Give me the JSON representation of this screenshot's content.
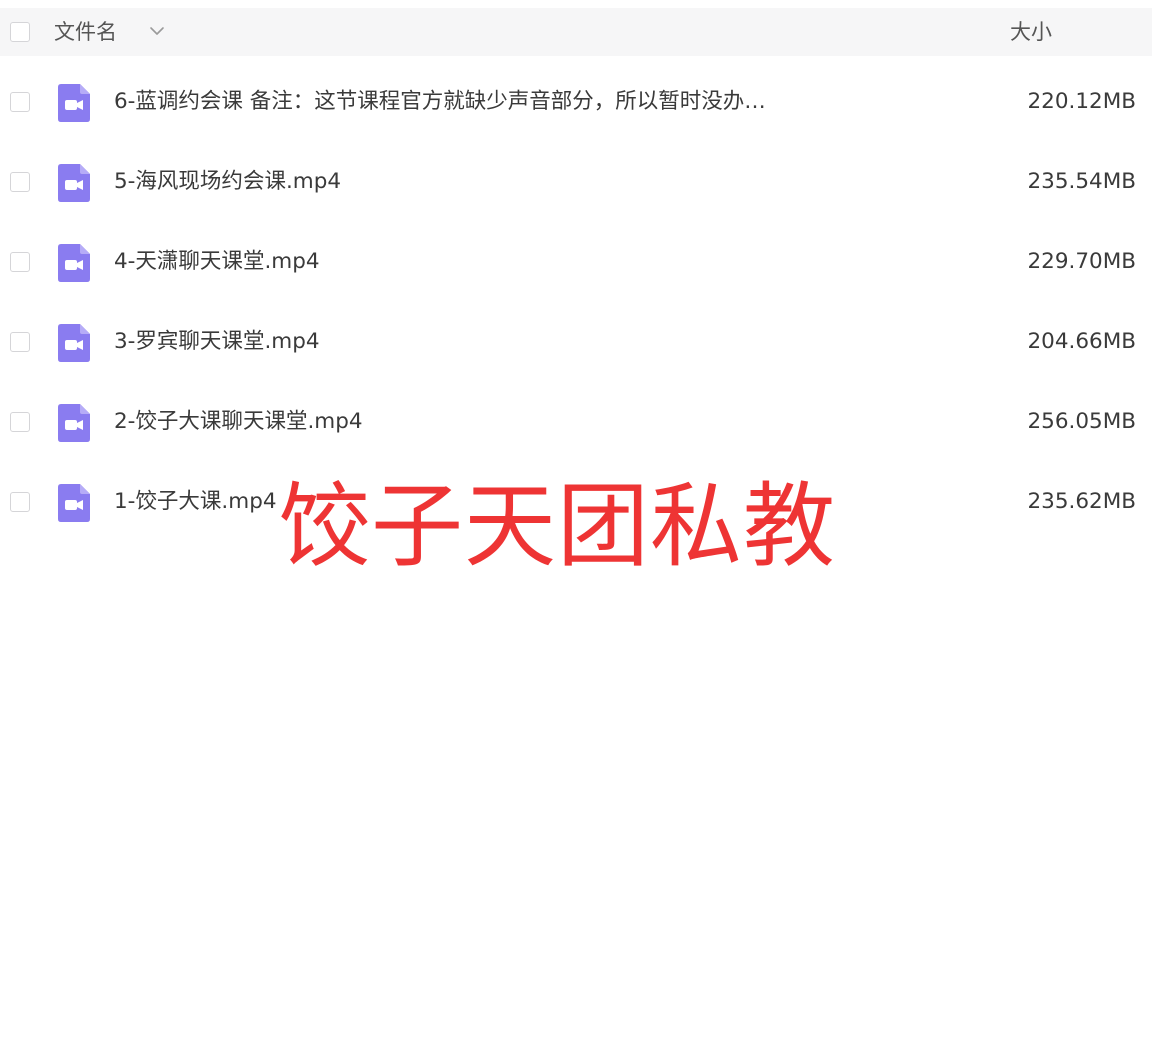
{
  "header": {
    "name_label": "文件名",
    "size_label": "大小"
  },
  "icons": {
    "sort": "chevron-down-icon",
    "file": "video-file-icon"
  },
  "colors": {
    "file_icon": "#8a7cf0",
    "watermark": "#ee3434"
  },
  "files": [
    {
      "name": "6-蓝调约会课 备注：这节课程官方就缺少声音部分，所以暂时没办…",
      "size": "220.12MB"
    },
    {
      "name": "5-海风现场约会课.mp4",
      "size": "235.54MB"
    },
    {
      "name": "4-天潇聊天课堂.mp4",
      "size": "229.70MB"
    },
    {
      "name": "3-罗宾聊天课堂.mp4",
      "size": "204.66MB"
    },
    {
      "name": "2-饺子大课聊天课堂.mp4",
      "size": "256.05MB"
    },
    {
      "name": "1-饺子大课.mp4",
      "size": "235.62MB"
    }
  ],
  "watermark": "饺子天团私教"
}
